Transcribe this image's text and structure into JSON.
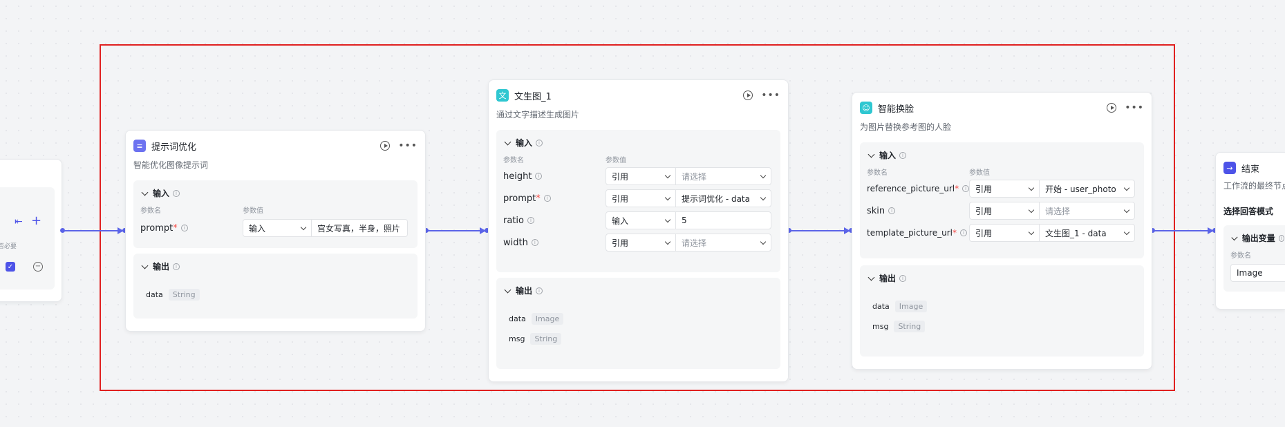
{
  "start_node": {
    "required_label": "是否必要"
  },
  "node_prompt_opt": {
    "title": "提示词优化",
    "desc": "智能优化图像提示词",
    "input_title": "输入",
    "col_name": "参数名",
    "col_value": "参数值",
    "params": [
      {
        "name": "prompt",
        "required": "*",
        "mode": "输入",
        "value": "宫女写真，半身，照片"
      }
    ],
    "output_title": "输出",
    "outputs": [
      {
        "name": "data",
        "type": "String"
      }
    ]
  },
  "node_text2img": {
    "title": "文生图_1",
    "desc": "通过文字描述生成图片",
    "input_title": "输入",
    "col_name": "参数名",
    "col_value": "参数值",
    "params": [
      {
        "name": "height",
        "required": "",
        "mode": "引用",
        "value": "请选择"
      },
      {
        "name": "prompt",
        "required": "*",
        "mode": "引用",
        "value": "提示词优化 - data"
      },
      {
        "name": "ratio",
        "required": "",
        "mode": "输入",
        "value": "5"
      },
      {
        "name": "width",
        "required": "",
        "mode": "引用",
        "value": "请选择"
      }
    ],
    "output_title": "输出",
    "outputs": [
      {
        "name": "data",
        "type": "Image"
      },
      {
        "name": "msg",
        "type": "String"
      }
    ]
  },
  "node_faceswap": {
    "title": "智能换脸",
    "desc": "为图片替换参考图的人脸",
    "input_title": "输入",
    "col_name": "参数名",
    "col_value": "参数值",
    "params": [
      {
        "name": "reference_picture_url",
        "required": "*",
        "mode": "引用",
        "value": "开始 - user_photo"
      },
      {
        "name": "skin",
        "required": "",
        "mode": "引用",
        "value": "请选择"
      },
      {
        "name": "template_picture_url",
        "required": "*",
        "mode": "引用",
        "value": "文生图_1 - data"
      }
    ],
    "output_title": "输出",
    "outputs": [
      {
        "name": "data",
        "type": "Image"
      },
      {
        "name": "msg",
        "type": "String"
      }
    ]
  },
  "node_end": {
    "title": "结束",
    "desc": "工作流的最终节点",
    "answer_mode_label": "选择回答模式",
    "output_var_title": "输出变量",
    "col_name": "参数名",
    "param_value": "Image"
  },
  "colors": {
    "accent": "#4d53e8",
    "edge": "#5b64e8",
    "selection": "#e02020",
    "icon_prompt": "#6c72f0",
    "icon_text2img": "#2fc7d1",
    "icon_faceswap": "#2fc7d1",
    "icon_end": "#4d53e8"
  }
}
